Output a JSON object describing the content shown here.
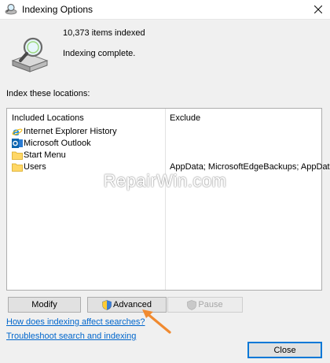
{
  "window": {
    "title": "Indexing Options"
  },
  "status": {
    "items_indexed": "10,373 items indexed",
    "state": "Indexing complete."
  },
  "locations": {
    "section_label": "Index these locations:",
    "col_included": "Included Locations",
    "col_exclude": "Exclude",
    "rows": [
      {
        "label": "Internet Explorer History",
        "exclude": "",
        "icon": "internet-explorer-icon"
      },
      {
        "label": "Microsoft Outlook",
        "exclude": "",
        "icon": "outlook-icon"
      },
      {
        "label": "Start Menu",
        "exclude": "",
        "icon": "folder-icon"
      },
      {
        "label": "Users",
        "exclude": "AppData; MicrosoftEdgeBackups; AppDat...",
        "icon": "folder-icon"
      }
    ],
    "watermark": "RepairWin.com"
  },
  "buttons": {
    "modify": "Modify",
    "advanced": "Advanced",
    "pause": "Pause",
    "close": "Close"
  },
  "links": {
    "how_indexing": "How does indexing affect searches?",
    "troubleshoot": "Troubleshoot search and indexing"
  },
  "colors": {
    "accent": "#0078d7",
    "link": "#0066cc",
    "folder": "#ffd766",
    "annotation_arrow": "#f08a30"
  }
}
